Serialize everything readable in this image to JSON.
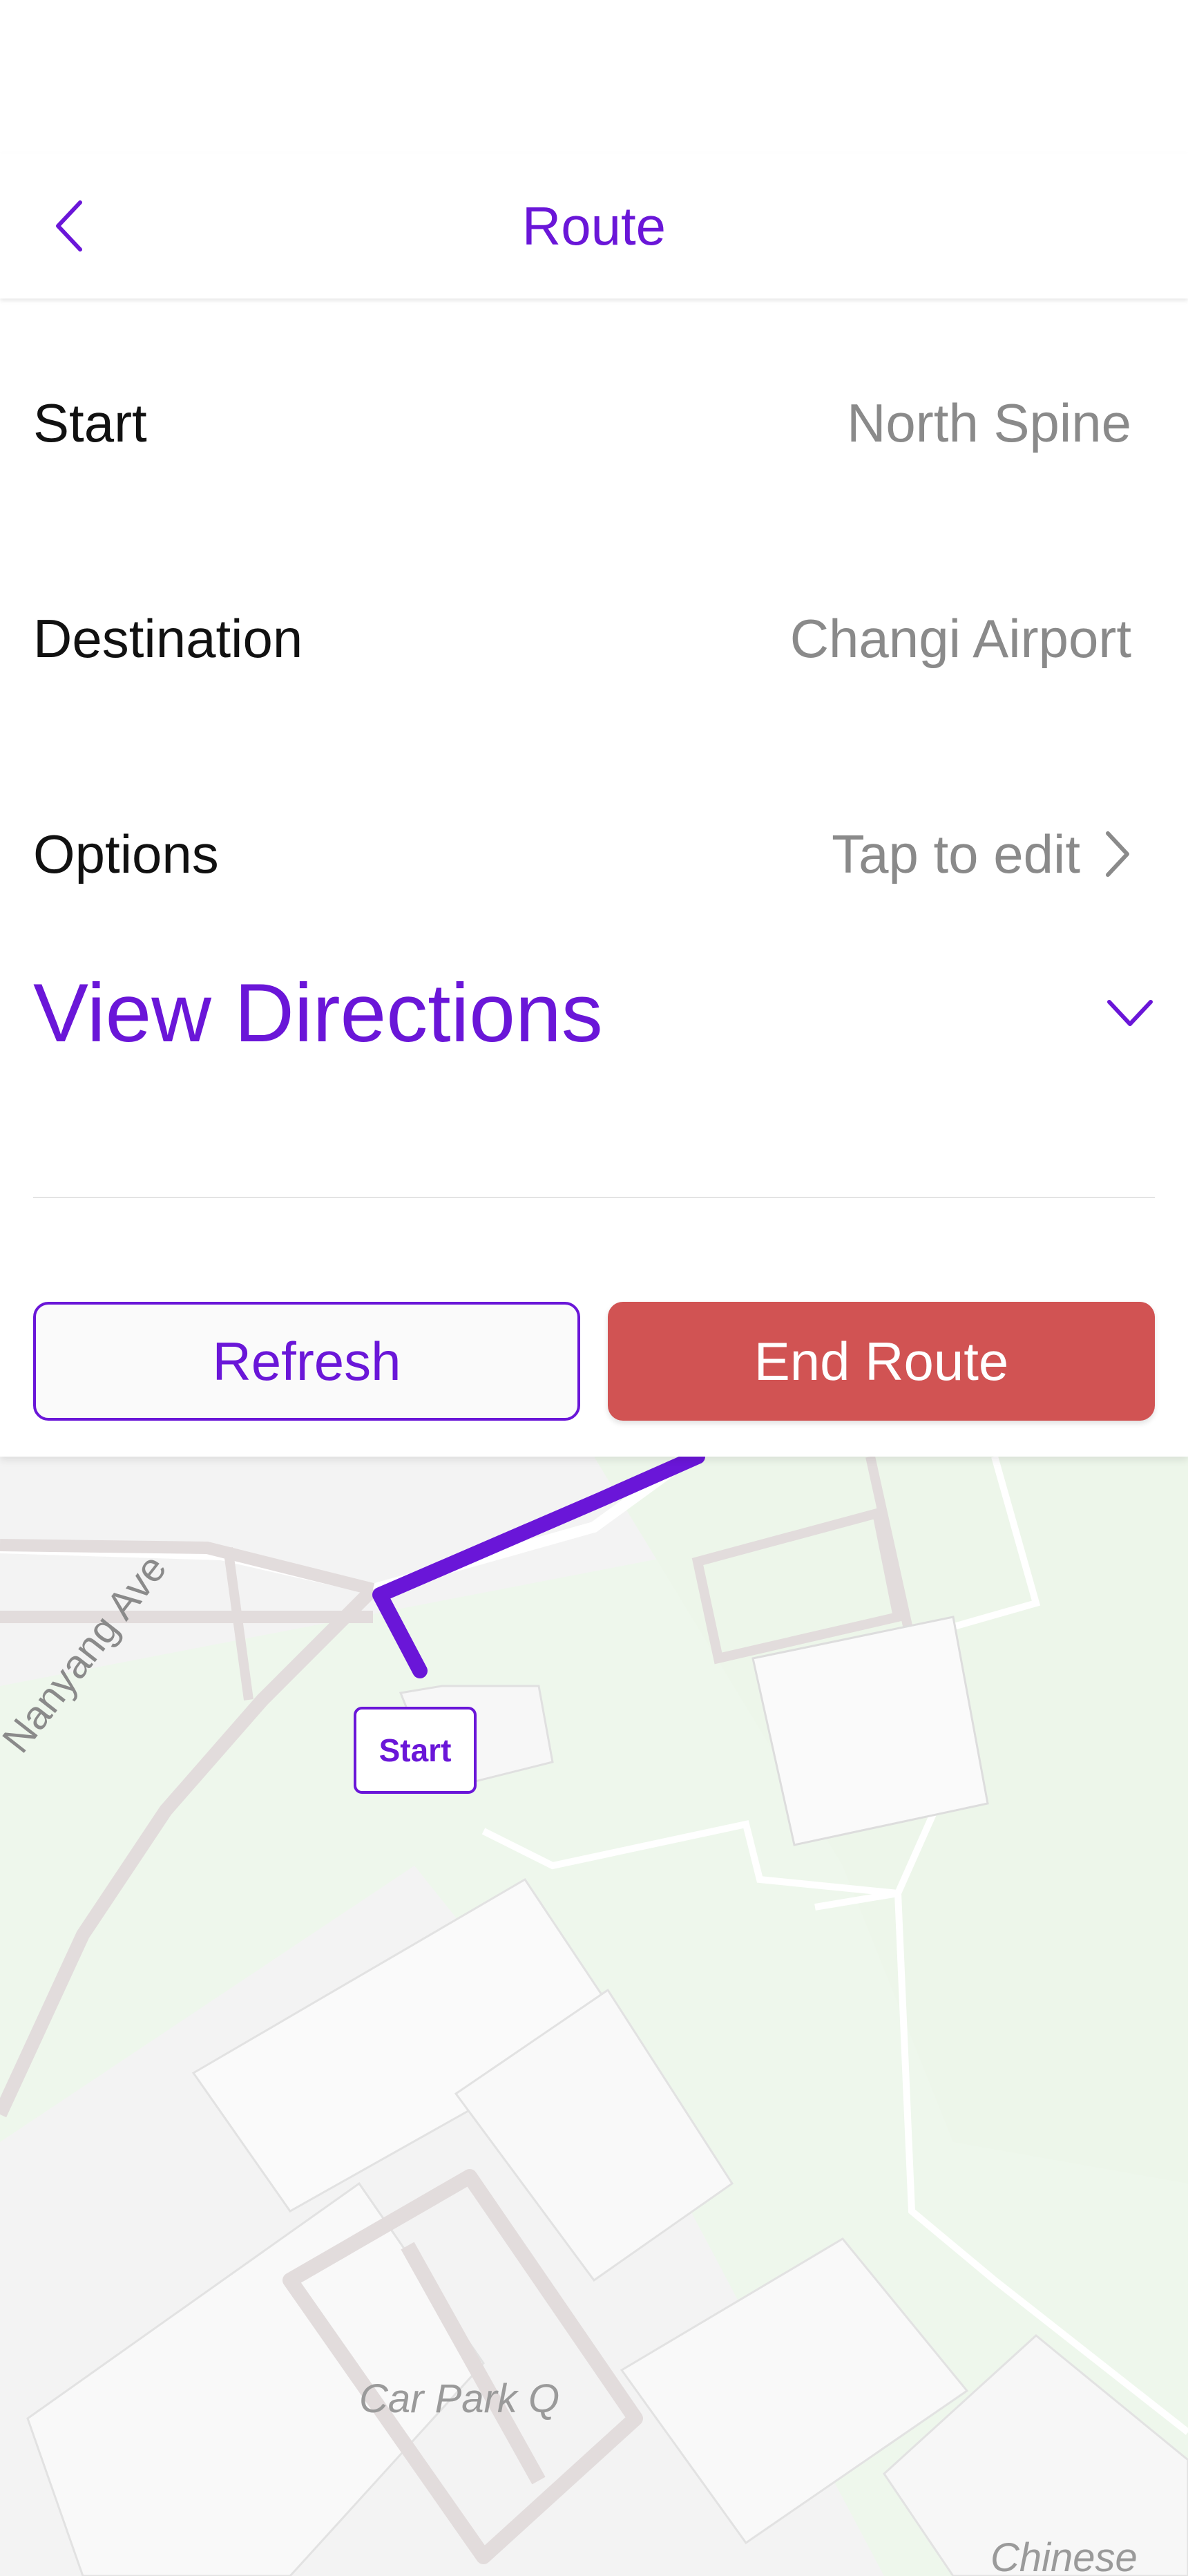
{
  "header": {
    "title": "Route",
    "back_icon": "chevron-left-icon"
  },
  "fields": {
    "start": {
      "label": "Start",
      "value": "North Spine"
    },
    "destination": {
      "label": "Destination",
      "value": "Changi Airport"
    },
    "options": {
      "label": "Options",
      "value": "Tap to edit",
      "icon": "chevron-right-icon"
    }
  },
  "directions": {
    "label": "View Directions",
    "icon": "chevron-down-icon"
  },
  "buttons": {
    "refresh": "Refresh",
    "end_route": "End Route"
  },
  "map": {
    "start_marker": "Start",
    "labels": {
      "road": "Nanyang Ave",
      "car_park": "Car Park Q",
      "building": "Chinese He"
    }
  },
  "colors": {
    "accent": "#6a16d8",
    "danger": "#d15353",
    "map_green": "#eef7ec",
    "map_bg": "#f3f3f3"
  }
}
